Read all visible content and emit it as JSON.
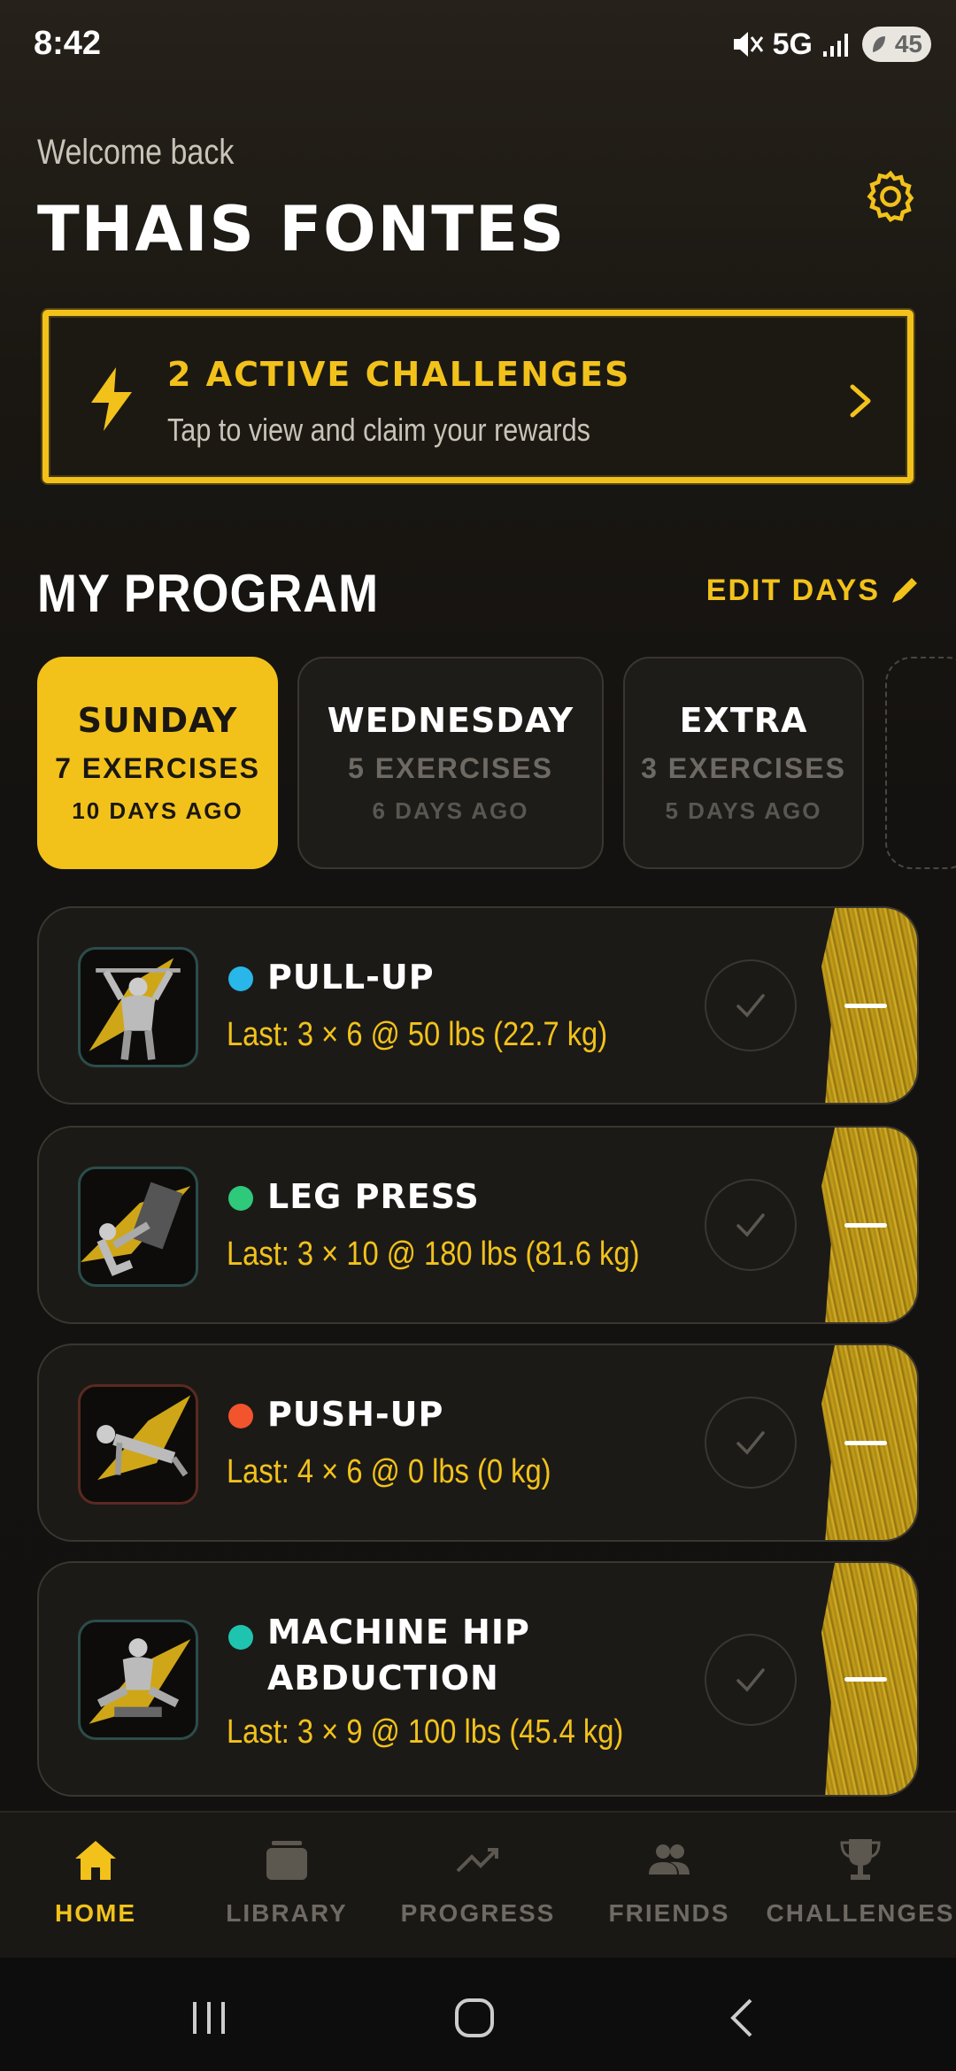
{
  "status_bar": {
    "time": "8:42",
    "network": "5G",
    "battery": "45"
  },
  "header": {
    "welcome": "Welcome back",
    "user_name": "THAIS FONTES"
  },
  "challenge_banner": {
    "title": "2 ACTIVE CHALLENGES",
    "subtitle": "Tap to view and claim your rewards"
  },
  "program": {
    "title": "MY PROGRAM",
    "edit_label": "EDIT DAYS",
    "days": [
      {
        "name": "SUNDAY",
        "count": "7 EXERCISES",
        "ago": "10 DAYS AGO",
        "active": true
      },
      {
        "name": "WEDNESDAY",
        "count": "5 EXERCISES",
        "ago": "6 DAYS AGO",
        "active": false
      },
      {
        "name": "EXTRA",
        "count": "3 EXERCISES",
        "ago": "5 DAYS AGO",
        "active": false
      }
    ]
  },
  "exercises": [
    {
      "name": "PULL-UP",
      "last": "Last: 3 × 6 @ 50 lbs (22.7 kg)",
      "dot_color": "#29b6e8"
    },
    {
      "name": "LEG PRESS",
      "last": "Last: 3 × 10 @ 180 lbs (81.6 kg)",
      "dot_color": "#2ec97a"
    },
    {
      "name": "PUSH-UP",
      "last": "Last: 4 × 6 @ 0 lbs (0 kg)",
      "dot_color": "#f2542d"
    },
    {
      "name_line1": "MACHINE HIP",
      "name_line2": "ABDUCTION",
      "last": "Last: 3 × 9 @ 100 lbs (45.4 kg)",
      "dot_color": "#1fc4b0"
    }
  ],
  "bottom_nav": [
    {
      "label": "HOME",
      "icon": "home-icon",
      "active": true
    },
    {
      "label": "LIBRARY",
      "icon": "library-icon",
      "active": false
    },
    {
      "label": "PROGRESS",
      "icon": "trending-up-icon",
      "active": false
    },
    {
      "label": "FRIENDS",
      "icon": "people-icon",
      "active": false
    },
    {
      "label": "CHALLENGES",
      "icon": "trophy-icon",
      "active": false
    }
  ],
  "colors": {
    "accent": "#f2c21b",
    "background": "#141210",
    "card": "#1c1a17"
  }
}
